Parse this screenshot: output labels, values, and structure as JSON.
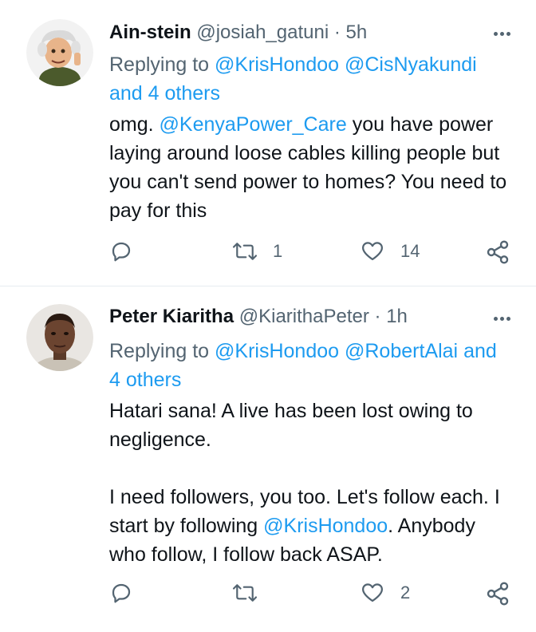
{
  "tweets": [
    {
      "name": "Ain-stein",
      "handle": "@josiah_gatuni",
      "dot": "·",
      "time": "5h",
      "replying_prefix": "Replying to",
      "replying_links": [
        "@KrisHondoo",
        "@CisNyakundi",
        "and 4 others"
      ],
      "body_parts": [
        {
          "text": "omg. ",
          "link": false
        },
        {
          "text": "@KenyaPower_Care",
          "link": true
        },
        {
          "text": " you have power laying around loose cables killing people but you can't send power to homes? You need to pay for this",
          "link": false
        }
      ],
      "replies": "",
      "retweets": "1",
      "likes": "14"
    },
    {
      "name": "Peter Kiaritha",
      "handle": "@KiarithaPeter",
      "dot": "·",
      "time": "1h",
      "replying_prefix": "Replying to",
      "replying_links": [
        "@KrisHondoo",
        "@RobertAlai",
        "and 4 others"
      ],
      "body_line1": "Hatari sana! A live has been lost owing to negligence.",
      "body_line2_parts": [
        {
          "text": "I need followers, you too. Let's follow each. I start by following ",
          "link": false
        },
        {
          "text": "@KrisHondoo",
          "link": true
        },
        {
          "text": ". Anybody who follow, I follow back ASAP.",
          "link": false
        }
      ],
      "replies": "",
      "retweets": "",
      "likes": "2"
    }
  ],
  "colors": {
    "link": "#1d9bf0",
    "muted": "#536471",
    "text": "#0f1419",
    "divider": "#e6ecf0"
  },
  "icons": [
    "reply-icon",
    "retweet-icon",
    "like-icon",
    "share-icon",
    "more-icon"
  ]
}
